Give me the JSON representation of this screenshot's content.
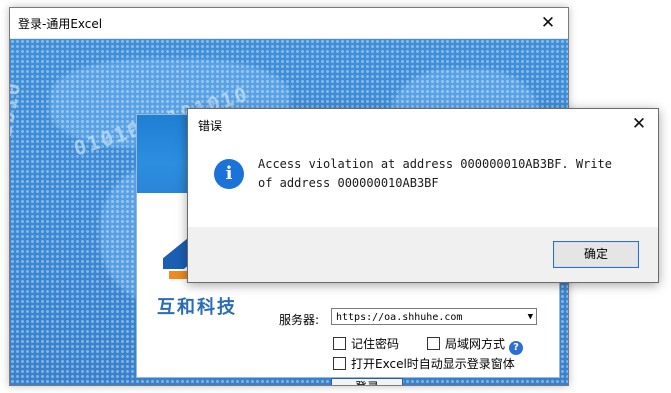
{
  "login_window": {
    "title": "登录-通用Excel",
    "close_glyph": "✕",
    "background_binary": "0101010101010",
    "logo_text": "互和科技",
    "server_label": "服务器:",
    "server_value": "https://oa.shhuhe.com",
    "remember_password_label": "记住密码",
    "lan_mode_label": "局域网方式",
    "auto_show_label": "打开Excel时自动显示登录窗体",
    "login_button_label": "登录"
  },
  "error_dialog": {
    "title": "错误",
    "close_glyph": "✕",
    "message": "Access violation at address 000000010AB3BF. Write of address 000000010AB3BF",
    "ok_button_label": "确定"
  },
  "colors": {
    "login_bg": "#3c8ad6",
    "panel_header": "#2a85d7",
    "logo_blue": "#1a5fb4",
    "logo_orange": "#f08a1c",
    "info_icon": "#1b72d8",
    "focus_border": "#2c6fd0"
  },
  "icons": {
    "error_icon": "info-circle-icon",
    "help_icon": "question-circle-icon"
  }
}
